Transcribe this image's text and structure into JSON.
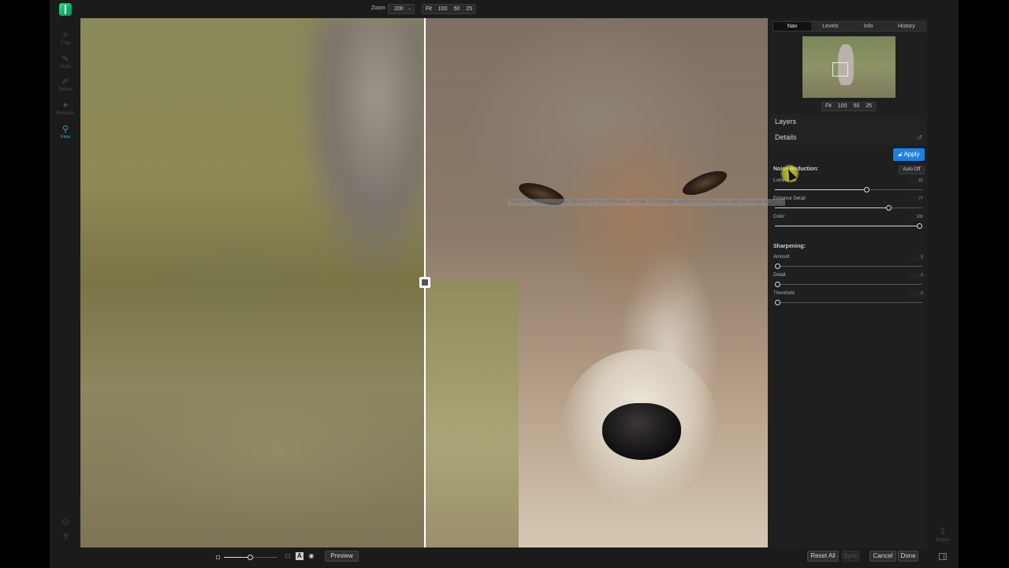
{
  "toolbar": {
    "zoom_label": "Zoom",
    "zoom_value": "200",
    "zoom_presets": [
      "Fit",
      "100",
      "50",
      "25"
    ]
  },
  "tools": [
    {
      "label": "Crop",
      "icon": "crop-icon",
      "active": false
    },
    {
      "label": "Mask",
      "icon": "mask-brush-icon",
      "active": false
    },
    {
      "label": "Refine",
      "icon": "refine-brush-icon",
      "active": false
    },
    {
      "label": "Retouch",
      "icon": "retouch-icon",
      "active": false
    },
    {
      "label": "View",
      "icon": "magnifier-icon",
      "active": true
    }
  ],
  "panel": {
    "tabs": [
      "Nav",
      "Levels",
      "Info",
      "History"
    ],
    "active_tab": "Nav",
    "nav_presets": [
      "Fit",
      "100",
      "50",
      "25"
    ],
    "layers_title": "Layers",
    "details_title": "Details",
    "apply_label": "Apply",
    "auto_off_label": "Auto Off",
    "noise_reduction": {
      "title": "Noise Reduction:",
      "luminance": {
        "label": "Luminance",
        "value": "62",
        "fraction": 0.62
      },
      "enhance_detail": {
        "label": "Enhance Detail",
        "value": "77",
        "fraction": 0.77
      },
      "color": {
        "label": "Color",
        "value": "100",
        "fraction": 1.0
      }
    },
    "sharpening": {
      "title": "Sharpening:",
      "amount": {
        "label": "Amount",
        "value": "0",
        "fraction": 0
      },
      "detail": {
        "label": "Detail",
        "value": "0",
        "fraction": 0
      },
      "threshold": {
        "label": "Threshold",
        "value": "0",
        "fraction": 0
      }
    },
    "tooltip": "Adjusts the amount of noise reduction on the luminance, or detail, in the image. Using higher values can make the image look soft."
  },
  "bottom": {
    "preview_label": "Preview",
    "reset_all_label": "Reset All",
    "sync_label": "Sync",
    "cancel_label": "Cancel",
    "done_label": "Done",
    "export_label": "Export"
  },
  "colors": {
    "accent": "#1e7fe0",
    "active_tool": "#2ea4c8",
    "background": "#1b1b1b"
  }
}
